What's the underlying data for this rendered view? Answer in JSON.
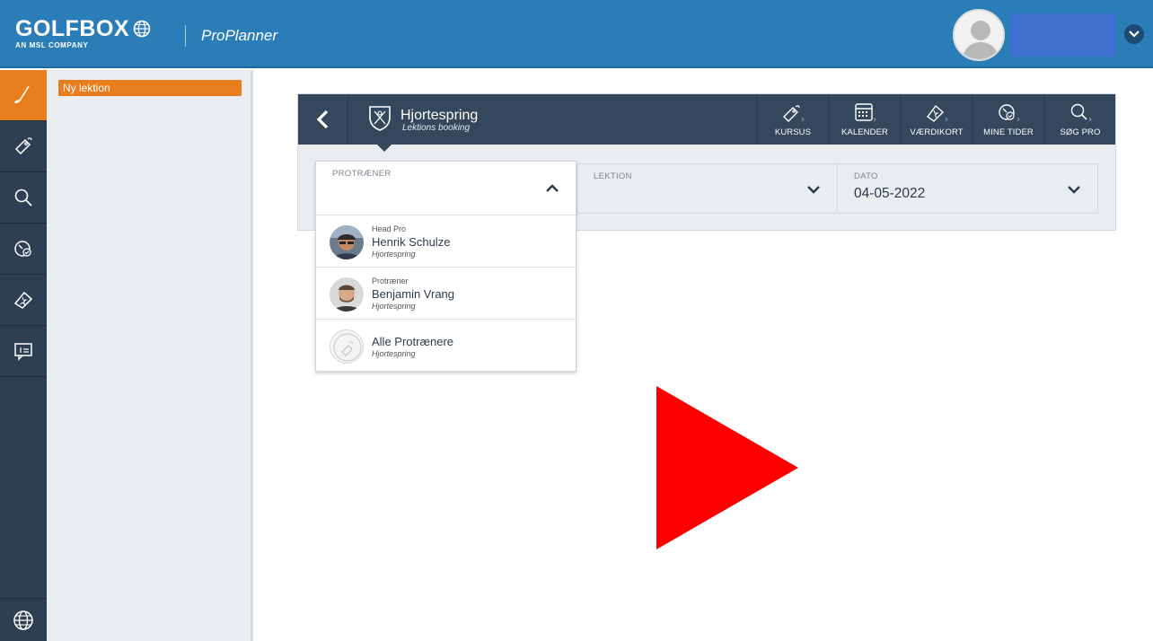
{
  "header": {
    "logo_text": "GOLFBOX",
    "logo_subtext": "AN MSL COMPANY",
    "app_name": "ProPlanner"
  },
  "colors": {
    "header_blue": "#2b7db7",
    "sidebar_dark": "#2e3f54",
    "accent_orange": "#e87d1e",
    "card_header": "#35475d",
    "play_red": "#ff0000"
  },
  "sidebar": {
    "items": [
      {
        "icon": "golf-club-icon",
        "active": true
      },
      {
        "icon": "ticket-icon",
        "active": false
      },
      {
        "icon": "search-icon",
        "active": false
      },
      {
        "icon": "clock-check-icon",
        "active": false
      },
      {
        "icon": "voucher-icon",
        "active": false
      },
      {
        "icon": "presentation-icon",
        "active": false
      }
    ],
    "bottom_icon": "globe-icon"
  },
  "leftpanel": {
    "item_label": "Ny lektion"
  },
  "card": {
    "club_name": "Hjortespring",
    "club_subtitle": "Lektions booking",
    "nav": [
      {
        "label": "KURSUS",
        "icon": "ticket-icon"
      },
      {
        "label": "KALENDER",
        "icon": "calendar-icon"
      },
      {
        "label": "VÆRDIKORT",
        "icon": "voucher-icon"
      },
      {
        "label": "MINE TIDER",
        "icon": "clock-check-icon"
      },
      {
        "label": "SØG PRO",
        "icon": "search-icon"
      }
    ],
    "fields": {
      "protraener_caption": "PROTRÆNER",
      "lektion_caption": "LEKTION",
      "dato_caption": "DATO",
      "dato_value": "04-05-2022"
    }
  },
  "dropdown": {
    "options": [
      {
        "role": "Head Pro",
        "name": "Henrik Schulze",
        "club": "Hjortespring"
      },
      {
        "role": "Protræner",
        "name": "Benjamin Vrang",
        "club": "Hjortespring"
      },
      {
        "role": "",
        "name": "Alle Protrænere",
        "club": "Hjortespring"
      }
    ]
  }
}
